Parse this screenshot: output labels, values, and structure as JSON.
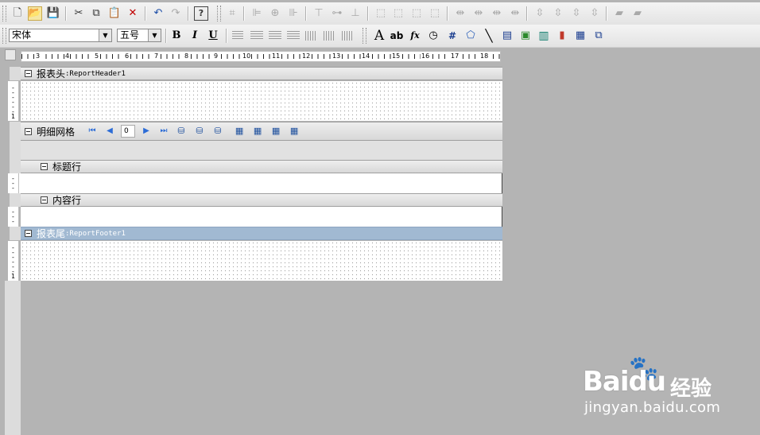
{
  "toolbar_row1": {
    "items": [
      {
        "name": "new-icon",
        "glyph": "🗋"
      },
      {
        "name": "open-icon",
        "glyph": "📂"
      },
      {
        "name": "save-icon",
        "glyph": "💾"
      },
      {
        "name": "cut-icon",
        "glyph": "✂"
      },
      {
        "name": "copy-icon",
        "glyph": "⧉"
      },
      {
        "name": "paste-icon",
        "glyph": "📋"
      },
      {
        "name": "delete-icon",
        "glyph": "✕"
      },
      {
        "name": "undo-icon",
        "glyph": "↶"
      },
      {
        "name": "redo-icon",
        "glyph": "↷"
      },
      {
        "name": "help-icon",
        "glyph": "?"
      }
    ]
  },
  "toolbar_row2": {
    "font_name": "宋体",
    "font_size": "五号",
    "bold_label": "B",
    "italic_label": "I",
    "underline_label": "U",
    "text_tool_label": "A",
    "ab_tool_label": "ab",
    "fx_tool_label": "fx"
  },
  "ruler": {
    "numbers": [
      "3",
      "4",
      "5",
      "6",
      "7",
      "8",
      "9",
      "10",
      "11",
      "12",
      "13",
      "14",
      "15",
      "16",
      "17",
      "18"
    ],
    "vertical_mark": "1"
  },
  "report": {
    "header_band_label": "报表头",
    "header_band_name": ":ReportHeader1",
    "detail_grid_label": "明细网格",
    "page_value": "0",
    "title_row_label": "标题行",
    "content_row_label": "内容行",
    "footer_band_label": "报表尾",
    "footer_band_name": ":ReportFooter1"
  },
  "watermark": {
    "brand": "Baidu",
    "brand_cn": "经验",
    "url": "jingyan.baidu.com"
  },
  "colors": {
    "workspace_bg": "#b4b4b4",
    "selected_band": "#a1b9d2",
    "nav_arrow": "#2c6cd6"
  }
}
